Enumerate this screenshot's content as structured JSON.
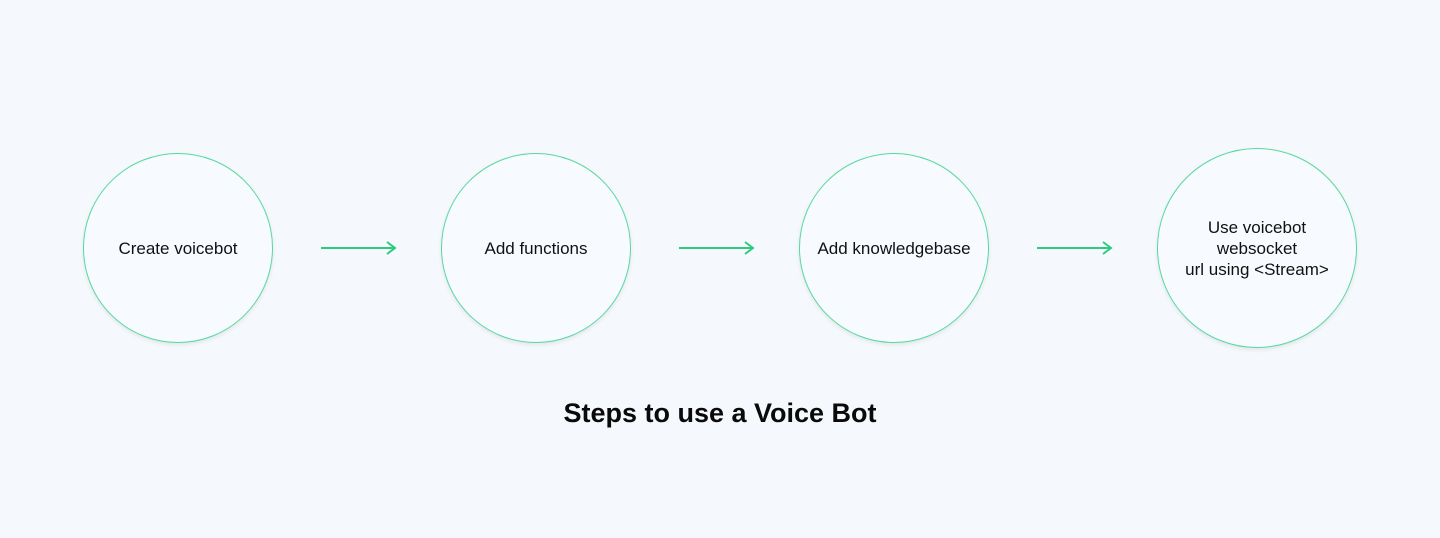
{
  "diagram": {
    "title": "Steps to use a Voice Bot",
    "accent_color": "#2ecb7e",
    "steps": [
      {
        "label": "Create voicebot"
      },
      {
        "label": "Add functions"
      },
      {
        "label": "Add knowledgebase"
      },
      {
        "label": "Use voicebot\nwebsocket\nurl using <Stream>"
      }
    ],
    "connectors": [
      {
        "from": "Create voicebot",
        "to": "Add functions",
        "icon": "arrow-right-icon"
      },
      {
        "from": "Add functions",
        "to": "Add knowledgebase",
        "icon": "arrow-right-icon"
      },
      {
        "from": "Add knowledgebase",
        "to": "Use voicebot websocket url using <Stream>",
        "icon": "arrow-right-icon"
      }
    ]
  }
}
